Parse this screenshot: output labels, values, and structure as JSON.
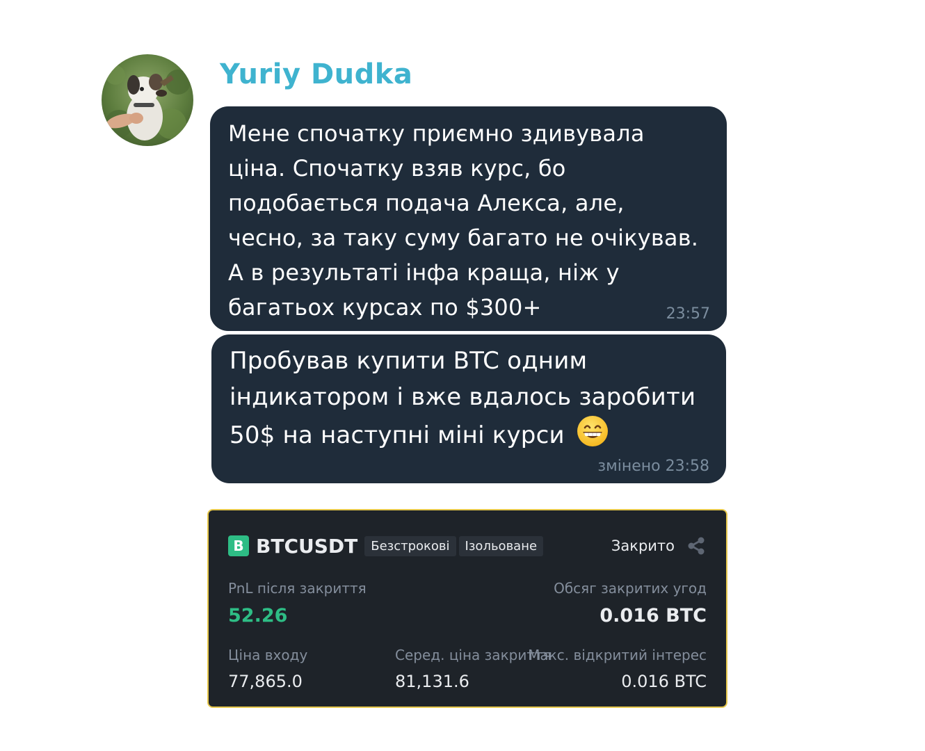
{
  "author": {
    "name": "Yuriy Dudka"
  },
  "messages": [
    {
      "text": "Мене спочатку приємно здивувала\nціна. Спочатку взяв курс, бо\nподобається подача Алекса, але,\nчесно, за таку суму багато не очікував.\nА в результаті інфа краща, ніж у\nбагатьох курсах по $300+",
      "time": "23:57"
    },
    {
      "text": "Пробував купити BTC одним\nіндикатором і вже вдалось заробити\n50$ на наступні міні курси",
      "emoji": "grinning-face",
      "time": "змінено 23:58"
    }
  ],
  "trade_card": {
    "badge": "B",
    "symbol": "BTCUSDT",
    "tags": [
      "Безстрокові",
      "Ізольоване"
    ],
    "status": "Закрито",
    "share_icon": "share-icon",
    "pnl_label": "PnL після закриття",
    "pnl_value": "52.26",
    "volume_label": "Обсяг закритих угод",
    "volume_value": "0.016 BTC",
    "entry_label": "Ціна входу",
    "entry_value": "77,865.0",
    "avg_close_label": "Серед. ціна закриття",
    "avg_close_value": "81,131.6",
    "max_oi_label": "Макс. відкритий інтерес",
    "max_oi_value": "0.016 BTC",
    "colors": {
      "accent_green": "#2ebd85",
      "border": "#e7c84c",
      "background": "#1e2329"
    }
  },
  "colors": {
    "author_name": "#3fb3cf",
    "bubble": "#1f2c3a",
    "timestamp": "#7b8d9e"
  }
}
